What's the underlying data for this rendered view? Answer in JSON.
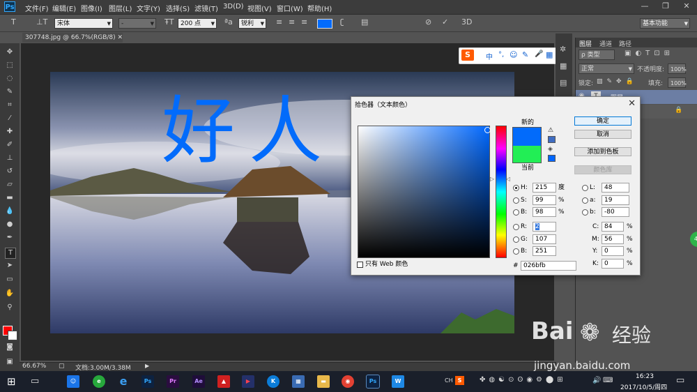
{
  "app": {
    "logo": "Ps"
  },
  "menu": [
    "文件(F)",
    "编辑(E)",
    "图像(I)",
    "图层(L)",
    "文字(Y)",
    "选择(S)",
    "滤镜(T)",
    "3D(D)",
    "视图(V)",
    "窗口(W)",
    "帮助(H)"
  ],
  "options_bar": {
    "font_family": "宋体",
    "font_style": "-",
    "font_size": "200 点",
    "aa_label": "ªa",
    "antialias": "锐利",
    "threed": "3D",
    "workspace": "基本功能",
    "text_color": "#026bfb"
  },
  "document": {
    "tab": "307748.jpg @ 66.7%(RGB/8)",
    "canvas_text": "好人",
    "zoom": "66.67%",
    "doc_size": "文档:3.00M/3.38M"
  },
  "sogou_bar": {
    "brand": "S",
    "items": [
      "中",
      "°,",
      "☺",
      "✎",
      "🎤",
      "▦"
    ]
  },
  "layers_panel": {
    "tabs": [
      "图层",
      "通道",
      "路径"
    ],
    "filter_label": "ρ 类型",
    "blend_mode": "正常",
    "opacity_label": "不透明度:",
    "opacity_value": "100%",
    "lock_label": "锁定:",
    "fill_label": "填充:",
    "fill_value": "100%",
    "layer_name": "图层",
    "layer_thumb": "T"
  },
  "color_picker": {
    "title": "拾色器（文本颜色）",
    "new_label": "新的",
    "current_label": "当前",
    "new_color": "#026bfb",
    "current_color": "#22ee55",
    "buttons": {
      "ok": "确定",
      "cancel": "取消",
      "add_swatch": "添加到色板",
      "libraries": "颜色库"
    },
    "web_only_label": "只有 Web 颜色",
    "hsb": {
      "h": "215",
      "h_unit": "度",
      "s": "99",
      "b": "98",
      "pct": "%"
    },
    "rgb": {
      "r": "2",
      "g": "107",
      "b": "251"
    },
    "lab": {
      "l": "48",
      "a": "19",
      "b": "-80"
    },
    "cmyk": {
      "c": "84",
      "m": "56",
      "y": "0",
      "k": "0",
      "pct": "%"
    },
    "hex": "026bfb",
    "hex_label": "#",
    "labels": {
      "h": "H:",
      "s": "S:",
      "b": "B:",
      "r": "R:",
      "g": "G:",
      "bb": "B:",
      "l": "L:",
      "a": "a:",
      "lb": "b:",
      "c": "C:",
      "m": "M:",
      "y": "Y:",
      "k": "K:"
    }
  },
  "taskbar": {
    "time": "16:23",
    "date": "2017/10/5/周四",
    "apps": [
      "Ps",
      "Pr",
      "Ae",
      "K",
      "Ps",
      "W"
    ],
    "tray_ch": "CH",
    "tray_s": "S"
  },
  "watermark": {
    "brand": "Bai",
    "brand_tail": "经验",
    "url": "jingyan.baidu.com"
  },
  "side_badge": "41"
}
